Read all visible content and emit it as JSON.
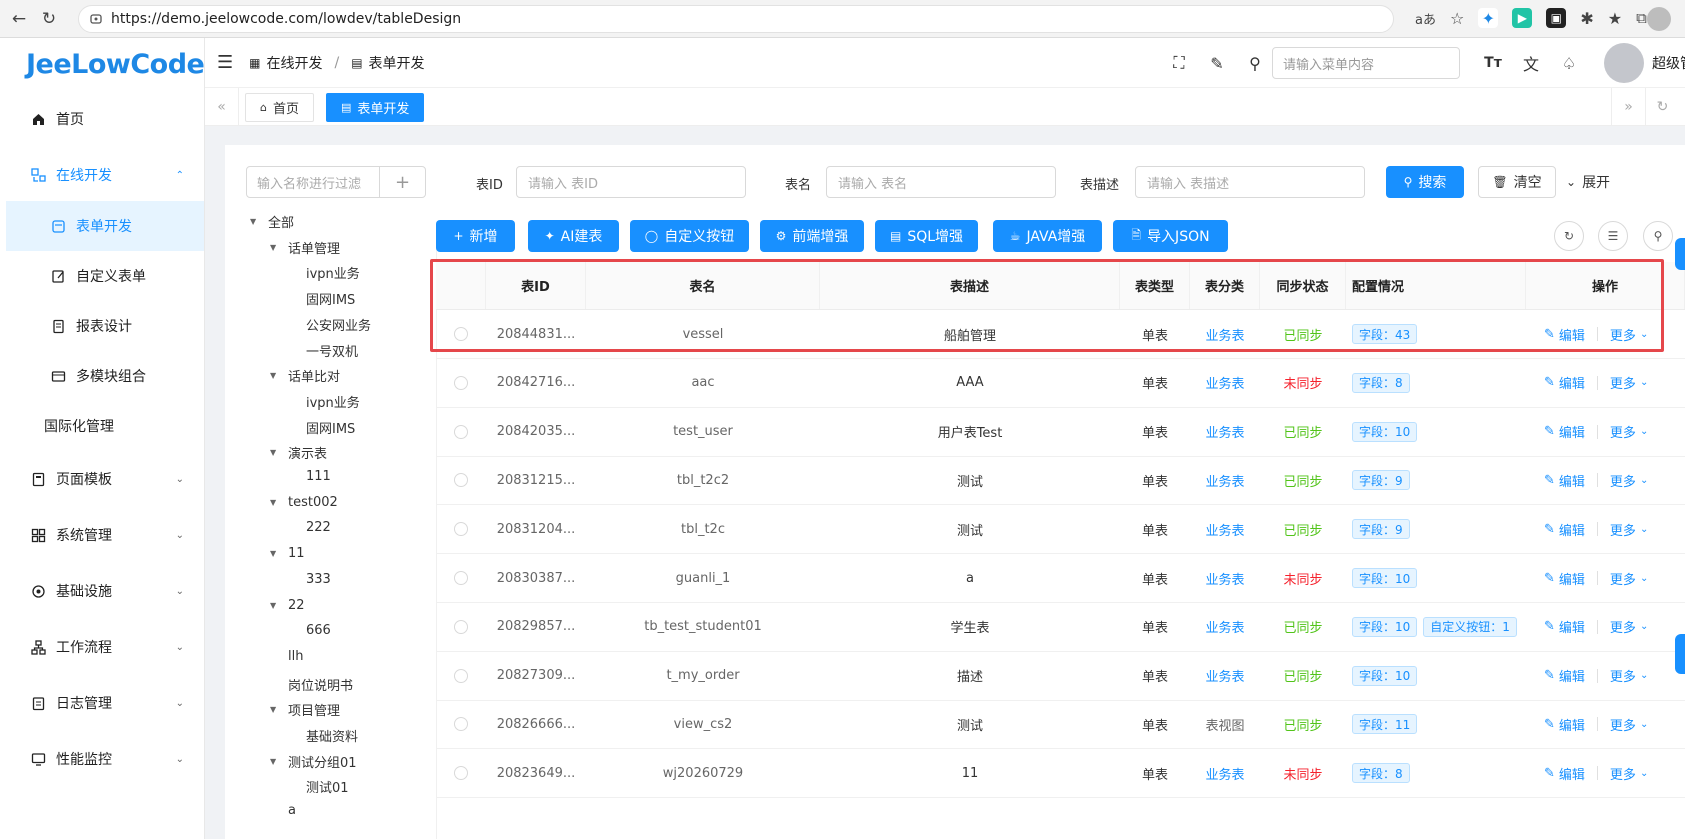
{
  "browser": {
    "url": "https://demo.jeelowcode.com/lowdev/tableDesign"
  },
  "sidebar": {
    "logo": "JeeLowCode",
    "items": [
      {
        "label": "首页",
        "icon": "home-icon"
      },
      {
        "label": "在线开发",
        "icon": "dev-icon"
      },
      {
        "label": "表单开发",
        "icon": "form-icon"
      },
      {
        "label": "自定义表单",
        "icon": "edit-icon"
      },
      {
        "label": "报表设计",
        "icon": "report-icon"
      },
      {
        "label": "多模块组合",
        "icon": "module-icon"
      },
      {
        "label": "国际化管理",
        "icon": ""
      },
      {
        "label": "页面模板",
        "icon": "template-icon"
      },
      {
        "label": "系统管理",
        "icon": "system-icon"
      },
      {
        "label": "基础设施",
        "icon": "infra-icon"
      },
      {
        "label": "工作流程",
        "icon": "workflow-icon"
      },
      {
        "label": "日志管理",
        "icon": "log-icon"
      },
      {
        "label": "性能监控",
        "icon": "monitor-icon"
      }
    ]
  },
  "header": {
    "breadcrumb": [
      "在线开发",
      "表单开发"
    ],
    "menu_search_placeholder": "请输入菜单内容",
    "username": "超级管理"
  },
  "tabs": [
    {
      "label": "首页"
    },
    {
      "label": "表单开发"
    }
  ],
  "tree": {
    "search_placeholder": "输入名称进行过滤",
    "nodes": [
      {
        "label": "全部"
      },
      {
        "label": "话单管理"
      },
      {
        "label": "ivpn业务"
      },
      {
        "label": "固网IMS"
      },
      {
        "label": "公安网业务"
      },
      {
        "label": "一号双机"
      },
      {
        "label": "话单比对"
      },
      {
        "label": "ivpn业务"
      },
      {
        "label": "固网IMS"
      },
      {
        "label": "演示表"
      },
      {
        "label": "111"
      },
      {
        "label": "test002"
      },
      {
        "label": "222"
      },
      {
        "label": "11"
      },
      {
        "label": "333"
      },
      {
        "label": "22"
      },
      {
        "label": "666"
      },
      {
        "label": "llh"
      },
      {
        "label": "岗位说明书"
      },
      {
        "label": "项目管理"
      },
      {
        "label": "基础资料"
      },
      {
        "label": "测试分组01"
      },
      {
        "label": "测试01"
      },
      {
        "label": "a"
      }
    ]
  },
  "filters": {
    "table_id_label": "表ID",
    "table_id_placeholder": "请输入 表ID",
    "table_name_label": "表名",
    "table_name_placeholder": "请输入 表名",
    "table_desc_label": "表描述",
    "table_desc_placeholder": "请输入 表描述",
    "search_button": "搜索",
    "clear_button": "清空",
    "expand_button": "展开"
  },
  "toolbar": {
    "add": "新增",
    "ai": "AI建表",
    "custom_button": "自定义按钮",
    "frontend": "前端增强",
    "sql": "SQL增强",
    "java": "JAVA增强",
    "import_json": "导入JSON"
  },
  "table": {
    "headers": [
      "表ID",
      "表名",
      "表描述",
      "表类型",
      "表分类",
      "同步状态",
      "配置情况",
      "操作"
    ],
    "edit_label": "编辑",
    "more_label": "更多",
    "rows": [
      {
        "id": "20844831...",
        "name": "vessel",
        "desc": "船舶管理",
        "type": "单表",
        "category": "业务表",
        "sync": "已同步",
        "synced": true,
        "tags": [
          "字段：43"
        ]
      },
      {
        "id": "20842716...",
        "name": "aac",
        "desc": "AAA",
        "type": "单表",
        "category": "业务表",
        "sync": "未同步",
        "synced": false,
        "tags": [
          "字段：8"
        ]
      },
      {
        "id": "20842035...",
        "name": "test_user",
        "desc": "用户表Test",
        "type": "单表",
        "category": "业务表",
        "sync": "已同步",
        "synced": true,
        "tags": [
          "字段：10"
        ]
      },
      {
        "id": "20831215...",
        "name": "tbl_t2c2",
        "desc": "测试",
        "type": "单表",
        "category": "业务表",
        "sync": "已同步",
        "synced": true,
        "tags": [
          "字段：9"
        ]
      },
      {
        "id": "20831204...",
        "name": "tbl_t2c",
        "desc": "测试",
        "type": "单表",
        "category": "业务表",
        "sync": "已同步",
        "synced": true,
        "tags": [
          "字段：9"
        ]
      },
      {
        "id": "20830387...",
        "name": "guanli_1",
        "desc": "a",
        "type": "单表",
        "category": "业务表",
        "sync": "未同步",
        "synced": false,
        "tags": [
          "字段：10"
        ]
      },
      {
        "id": "20829857...",
        "name": "tb_test_student01",
        "desc": "学生表",
        "type": "单表",
        "category": "业务表",
        "sync": "已同步",
        "synced": true,
        "tags": [
          "字段：10",
          "自定义按钮：1"
        ]
      },
      {
        "id": "20827309...",
        "name": "t_my_order",
        "desc": "描述",
        "type": "单表",
        "category": "业务表",
        "sync": "已同步",
        "synced": true,
        "tags": [
          "字段：10"
        ]
      },
      {
        "id": "20826666...",
        "name": "view_cs2",
        "desc": "测试",
        "type": "单表",
        "category": "表视图",
        "sync": "已同步",
        "synced": true,
        "tags": [
          "字段：11"
        ]
      },
      {
        "id": "20823649...",
        "name": "wj20260729",
        "desc": "11",
        "type": "单表",
        "category": "业务表",
        "sync": "未同步",
        "synced": false,
        "tags": [
          "字段：8"
        ]
      }
    ]
  },
  "colors": {
    "primary": "#1890ff",
    "success": "#52c41a",
    "danger": "#f5222d",
    "highlight": "#e5474b"
  }
}
